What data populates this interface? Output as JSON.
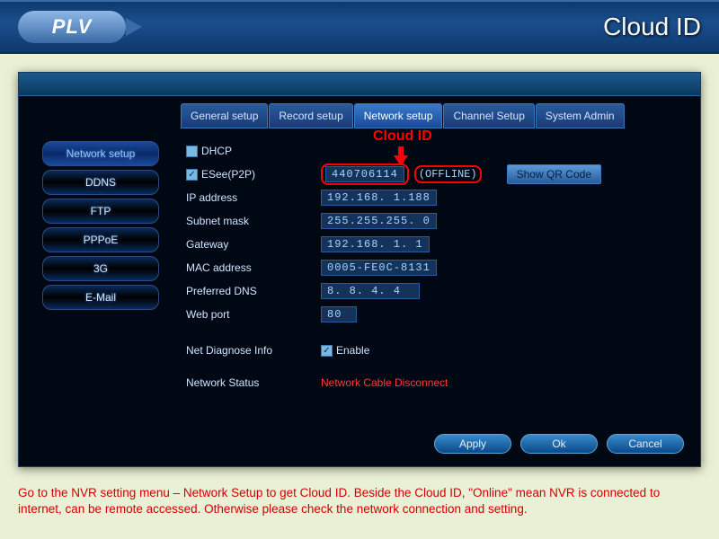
{
  "header": {
    "brand": "PLV",
    "title": "Cloud ID"
  },
  "tabs": [
    {
      "label": "General setup"
    },
    {
      "label": "Record setup"
    },
    {
      "label": "Network setup"
    },
    {
      "label": "Channel Setup"
    },
    {
      "label": "System Admin"
    }
  ],
  "sidebar": [
    {
      "label": "Network setup"
    },
    {
      "label": "DDNS"
    },
    {
      "label": "FTP"
    },
    {
      "label": "PPPoE"
    },
    {
      "label": "3G"
    },
    {
      "label": "E-Mail"
    }
  ],
  "annotation": "Cloud ID",
  "form": {
    "dhcp_label": "DHCP",
    "dhcp_checked": false,
    "esee_label": "ESee(P2P)",
    "esee_checked": true,
    "cloud_id": "440706114",
    "cloud_status": "(OFFLINE)",
    "qr_btn": "Show QR Code",
    "ip_label": "IP address",
    "ip_value": "192.168.  1.188",
    "mask_label": "Subnet mask",
    "mask_value": "255.255.255.  0",
    "gw_label": "Gateway",
    "gw_value": "192.168.  1.  1",
    "mac_label": "MAC address",
    "mac_value": "0005-FE0C-8131",
    "dns_label": "Preferred DNS",
    "dns_value": "  8.  8.  4.  4",
    "port_label": "Web port",
    "port_value": "80",
    "diag_label": "Net Diagnose Info",
    "diag_enable": "Enable",
    "diag_checked": true,
    "status_label": "Network Status",
    "status_value": "Network Cable Disconnect"
  },
  "buttons": {
    "apply": "Apply",
    "ok": "Ok",
    "cancel": "Cancel"
  },
  "caption": "Go to the NVR setting menu – Network Setup to get Cloud ID. Beside the Cloud ID, \"Online\" mean NVR is connected to internet, can be remote accessed. Otherwise please check the network connection and setting."
}
